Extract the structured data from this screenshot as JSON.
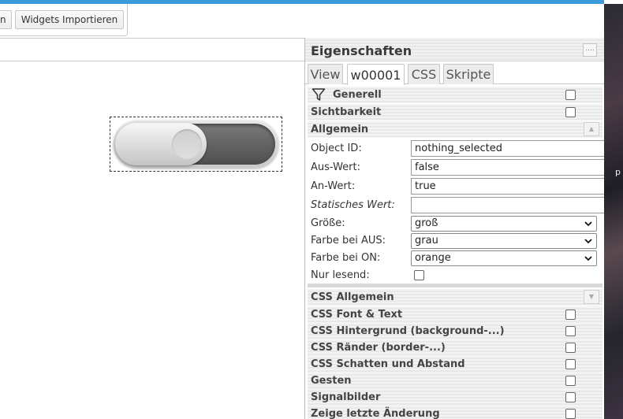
{
  "toolbar": {
    "partial_button_label": "n",
    "import_button_label": "Widgets Importieren"
  },
  "widget": {
    "type": "switch",
    "state": "off"
  },
  "panel": {
    "title": "Eigenschaften",
    "menu_button_glyph": "....",
    "tabs": [
      {
        "label": "View",
        "active": false
      },
      {
        "label": "w00001",
        "active": true
      },
      {
        "label": "CSS",
        "active": false
      },
      {
        "label": "Skripte",
        "active": false
      }
    ],
    "filter_group": {
      "label": "Generell",
      "checked": false
    },
    "visibility_group": {
      "label": "Sichtbarkeit",
      "checked": false
    },
    "general_section": {
      "label": "Allgemein",
      "expanded": true,
      "fields": {
        "object_id": {
          "label": "Object ID:",
          "value": "nothing_selected"
        },
        "off_value": {
          "label": "Aus-Wert:",
          "value": "false"
        },
        "on_value": {
          "label": "An-Wert:",
          "value": "true"
        },
        "static_value": {
          "label": "Statisches Wert:",
          "value": ""
        },
        "size": {
          "label": "Größe:",
          "value": "groß"
        },
        "color_off": {
          "label": "Farbe bei AUS:",
          "value": "grau"
        },
        "color_on": {
          "label": "Farbe bei ON:",
          "value": "orange"
        },
        "readonly": {
          "label": "Nur lesend:",
          "checked": false
        }
      }
    },
    "groups": [
      {
        "label": "CSS Allgemein",
        "collapsible": true
      },
      {
        "label": "CSS Font & Text",
        "checked": false
      },
      {
        "label": "CSS Hintergrund (background-...)",
        "checked": false
      },
      {
        "label": "CSS Ränder (border-...)",
        "checked": false
      },
      {
        "label": "CSS Schatten und Abstand",
        "checked": false
      },
      {
        "label": "Gesten",
        "checked": false
      },
      {
        "label": "Signalbilder",
        "checked": false
      },
      {
        "label": "Zeige letzte Änderung",
        "checked": false
      }
    ]
  },
  "background": {
    "edge_text": "p"
  },
  "colors": {
    "accent": "#3b9bd8",
    "panel_text": "#3a3a3a"
  }
}
